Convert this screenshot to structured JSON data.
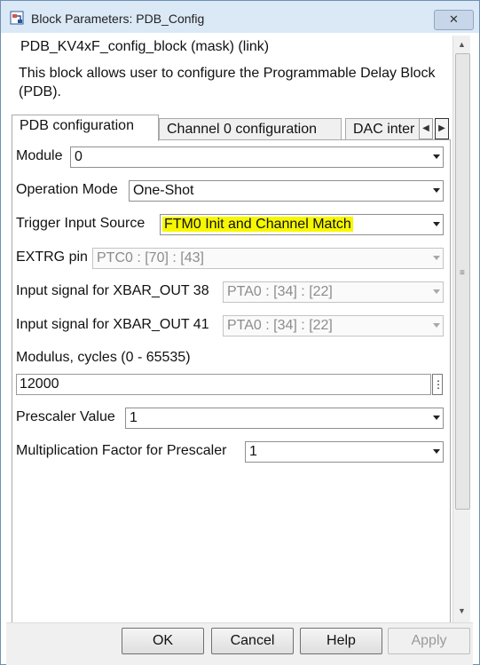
{
  "window": {
    "title": "Block Parameters: PDB_Config",
    "close_label": "✕"
  },
  "block": {
    "heading": "PDB_KV4xF_config_block (mask) (link)",
    "description": "This block allows user to configure the Programmable Delay Block (PDB)."
  },
  "tabs": [
    {
      "label": "PDB configuration",
      "active": true
    },
    {
      "label": "Channel 0 configuration",
      "active": false
    },
    {
      "label": "DAC inter",
      "active": false
    }
  ],
  "tab_scroll": {
    "left": "◀",
    "right": "▶"
  },
  "params": {
    "module": {
      "label": "Module",
      "value": "0"
    },
    "operation_mode": {
      "label": "Operation Mode",
      "value": "One-Shot"
    },
    "trigger_input_source": {
      "label": "Trigger Input Source",
      "value": "FTM0 Init and Channel Match"
    },
    "extrg_pin": {
      "label": "EXTRG pin",
      "value": "PTC0 : [70] : [43]"
    },
    "xbar_out_38": {
      "label": "Input signal for XBAR_OUT 38",
      "value": "PTA0 : [34] : [22]"
    },
    "xbar_out_41": {
      "label": "Input signal for XBAR_OUT 41",
      "value": "PTA0 : [34] : [22]"
    },
    "modulus": {
      "label": "Modulus, cycles (0 - 65535)",
      "value": "12000",
      "more": "⋮"
    },
    "prescaler": {
      "label": "Prescaler Value",
      "value": "1"
    },
    "mult_factor": {
      "label": "Multiplication Factor for Prescaler",
      "value": "1"
    }
  },
  "buttons": {
    "ok": "OK",
    "cancel": "Cancel",
    "help": "Help",
    "apply": "Apply"
  },
  "scrollbar": {
    "up": "▲",
    "down": "▼",
    "grip": "≡"
  },
  "colors": {
    "highlight": "#f7f700",
    "titlebar": "#dbe8f6"
  }
}
